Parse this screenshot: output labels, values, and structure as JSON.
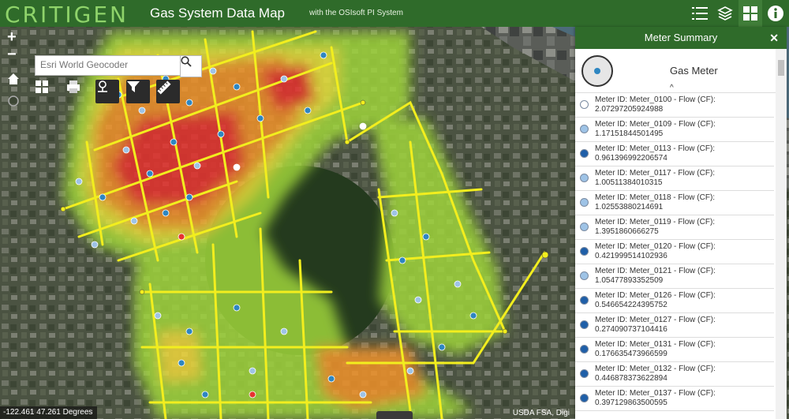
{
  "header": {
    "brand": "CRITIGEN",
    "title": "Gas System Data Map",
    "subtitle": "with the OSIsoft PI System",
    "buttons": [
      "list-icon",
      "layers-icon",
      "basemap-grid-icon",
      "info-icon"
    ]
  },
  "map": {
    "zoom_in": "+",
    "zoom_out": "−",
    "search": {
      "placeholder": "Esri World Geocoder"
    },
    "coords": "-122.461 47.261 Degrees",
    "attribution": "USDA FSA, Digi"
  },
  "panel": {
    "title": "Meter Summary",
    "meter_label": "Gas Meter",
    "rows": [
      {
        "line1": "Meter ID: Meter_0100 - Flow (CF):",
        "line2": "2.07297205924988",
        "color": "#ffffff"
      },
      {
        "line1": "Meter ID: Meter_0109 - Flow (CF):",
        "line2": "1.17151844501495",
        "color": "#9ec3e6"
      },
      {
        "line1": "Meter ID: Meter_0113 - Flow (CF):",
        "line2": "0.961396992206574",
        "color": "#1f5fa8"
      },
      {
        "line1": "Meter ID: Meter_0117 - Flow (CF):",
        "line2": "1.00511384010315",
        "color": "#9ec3e6"
      },
      {
        "line1": "Meter ID: Meter_0118 - Flow (CF):",
        "line2": "1.02553880214691",
        "color": "#9ec3e6"
      },
      {
        "line1": "Meter ID: Meter_0119 - Flow (CF):",
        "line2": "1.3951860666275",
        "color": "#9ec3e6"
      },
      {
        "line1": "Meter ID: Meter_0120 - Flow (CF):",
        "line2": "0.421999514102936",
        "color": "#1f5fa8"
      },
      {
        "line1": "Meter ID: Meter_0121 - Flow (CF):",
        "line2": "1.05477893352509",
        "color": "#9ec3e6"
      },
      {
        "line1": "Meter ID: Meter_0126 - Flow (CF):",
        "line2": "0.546654224395752",
        "color": "#1f5fa8"
      },
      {
        "line1": "Meter ID: Meter_0127 - Flow (CF):",
        "line2": "0.274090737104416",
        "color": "#1f5fa8"
      },
      {
        "line1": "Meter ID: Meter_0131 - Flow (CF):",
        "line2": "0.176635473966599",
        "color": "#1f5fa8"
      },
      {
        "line1": "Meter ID: Meter_0132 - Flow (CF):",
        "line2": "0.446878373622894",
        "color": "#1f5fa8"
      },
      {
        "line1": "Meter ID: Meter_0137 - Flow (CF):",
        "line2": "0.397129863500595",
        "color": "#1f5fa8"
      }
    ]
  },
  "colors": {
    "brand_green": "#2f6b2a",
    "brand_light": "#8fd36a",
    "main_line": "#f2ee1e"
  }
}
